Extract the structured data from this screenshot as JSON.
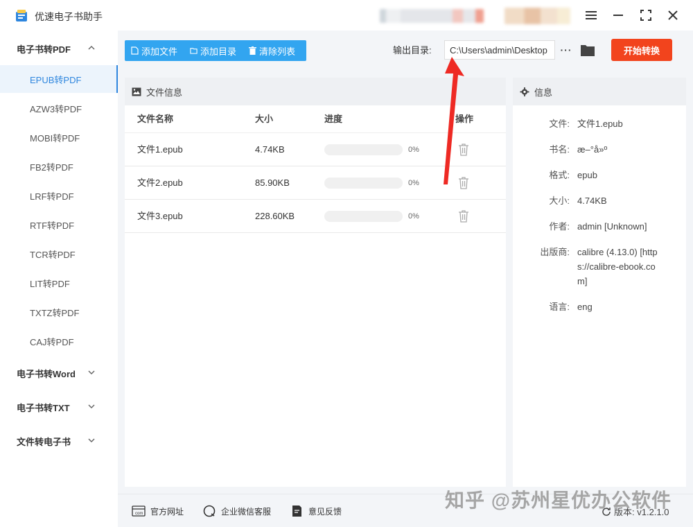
{
  "app": {
    "title": "优速电子书助手"
  },
  "sidebar": {
    "group_pdf": "电子书转PDF",
    "items": [
      {
        "label": "EPUB转PDF",
        "active": true
      },
      {
        "label": "AZW3转PDF"
      },
      {
        "label": "MOBI转PDF"
      },
      {
        "label": "FB2转PDF"
      },
      {
        "label": "LRF转PDF"
      },
      {
        "label": "RTF转PDF"
      },
      {
        "label": "TCR转PDF"
      },
      {
        "label": "LIT转PDF"
      },
      {
        "label": "TXTZ转PDF"
      },
      {
        "label": "CAJ转PDF"
      }
    ],
    "group_word": "电子书转Word",
    "group_txt": "电子书转TXT",
    "group_ebook": "文件转电子书"
  },
  "toolbar": {
    "add_file": "添加文件",
    "add_dir": "添加目录",
    "clear_list": "清除列表",
    "output_label": "输出目录:",
    "output_value": "C:\\Users\\admin\\Desktop",
    "more": "···",
    "start": "开始转换",
    "accent": "#32a5f0",
    "start_color": "#f2441d"
  },
  "file_panel": {
    "title": "文件信息",
    "columns": {
      "name": "文件名称",
      "size": "大小",
      "progress": "进度",
      "action": "操作"
    },
    "rows": [
      {
        "name": "文件1.epub",
        "size": "4.74KB",
        "progress": 0,
        "progress_text": "0%"
      },
      {
        "name": "文件2.epub",
        "size": "85.90KB",
        "progress": 0,
        "progress_text": "0%"
      },
      {
        "name": "文件3.epub",
        "size": "228.60KB",
        "progress": 0,
        "progress_text": "0%"
      }
    ]
  },
  "info_panel": {
    "title": "信息",
    "fields": [
      {
        "k": "文件:",
        "v": "文件1.epub"
      },
      {
        "k": "书名:",
        "v": "æ–°å»º"
      },
      {
        "k": "格式:",
        "v": "epub"
      },
      {
        "k": "大小:",
        "v": "4.74KB"
      },
      {
        "k": "作者:",
        "v": "admin [Unknown]"
      },
      {
        "k": "出版商:",
        "v": "calibre (4.13.0) [https://calibre-ebook.com]"
      },
      {
        "k": "语言:",
        "v": "eng"
      }
    ]
  },
  "footer": {
    "website": "官方网址",
    "wechat": "企业微信客服",
    "feedback": "意见反馈",
    "version": "版本: v1.2.1.0"
  },
  "watermark": "知乎 @苏州星优办公软件"
}
